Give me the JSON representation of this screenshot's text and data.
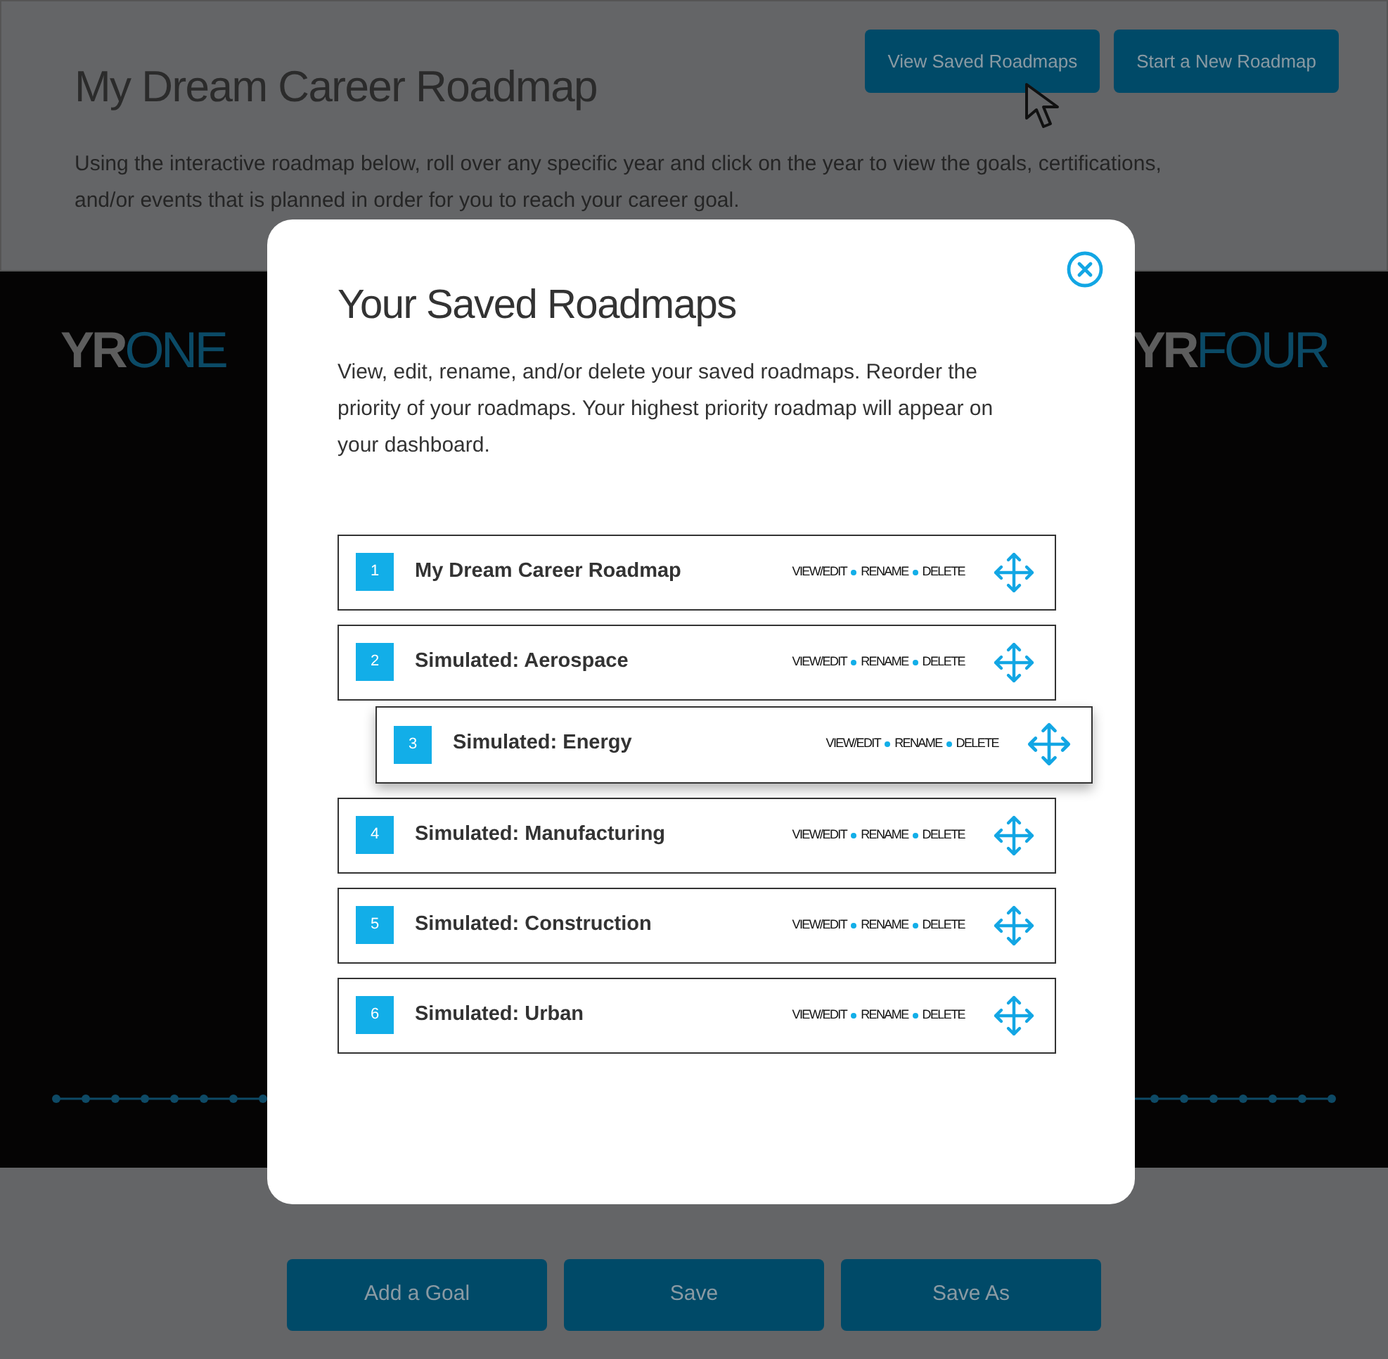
{
  "header": {
    "title": "My Dream Career Roadmap",
    "description": "Using the interactive roadmap below, roll over any specific year and click on the year to view the goals, certifications, and/or events that is planned in order for you to reach your career goal.",
    "buttons": [
      "View Saved Roadmaps",
      "Start a New Roadmap"
    ]
  },
  "years": [
    {
      "prefix": "YR",
      "suffix": "ONE"
    },
    {
      "prefix": "YR",
      "suffix": "FOUR"
    }
  ],
  "footer_buttons": [
    "Add a Goal",
    "Save",
    "Save As"
  ],
  "modal": {
    "title": "Your Saved Roadmaps",
    "description": "View, edit, rename, and/or delete your saved roadmaps. Reorder the priority of your roadmaps. Your highest priority roadmap will appear on your dashboard.",
    "roadmaps": [
      {
        "number": "1",
        "name": "My Dream Career Roadmap",
        "actions": [
          "VIEW/EDIT",
          "RENAME",
          "DELETE"
        ],
        "dragging": false
      },
      {
        "number": "2",
        "name": "Simulated: Aerospace",
        "actions": [
          "VIEW/EDIT",
          "RENAME",
          "DELETE"
        ],
        "dragging": false
      },
      {
        "number": "3",
        "name": "Simulated: Energy",
        "actions": [
          "VIEW/EDIT",
          "RENAME",
          "DELETE"
        ],
        "dragging": true
      },
      {
        "number": "4",
        "name": "Simulated: Manufacturing",
        "actions": [
          "VIEW/EDIT",
          "RENAME",
          "DELETE"
        ],
        "dragging": false
      },
      {
        "number": "5",
        "name": "Simulated: Construction",
        "actions": [
          "VIEW/EDIT",
          "RENAME",
          "DELETE"
        ],
        "dragging": false
      },
      {
        "number": "6",
        "name": "Simulated: Urban",
        "actions": [
          "VIEW/EDIT",
          "RENAME",
          "DELETE"
        ],
        "dragging": false
      }
    ]
  }
}
